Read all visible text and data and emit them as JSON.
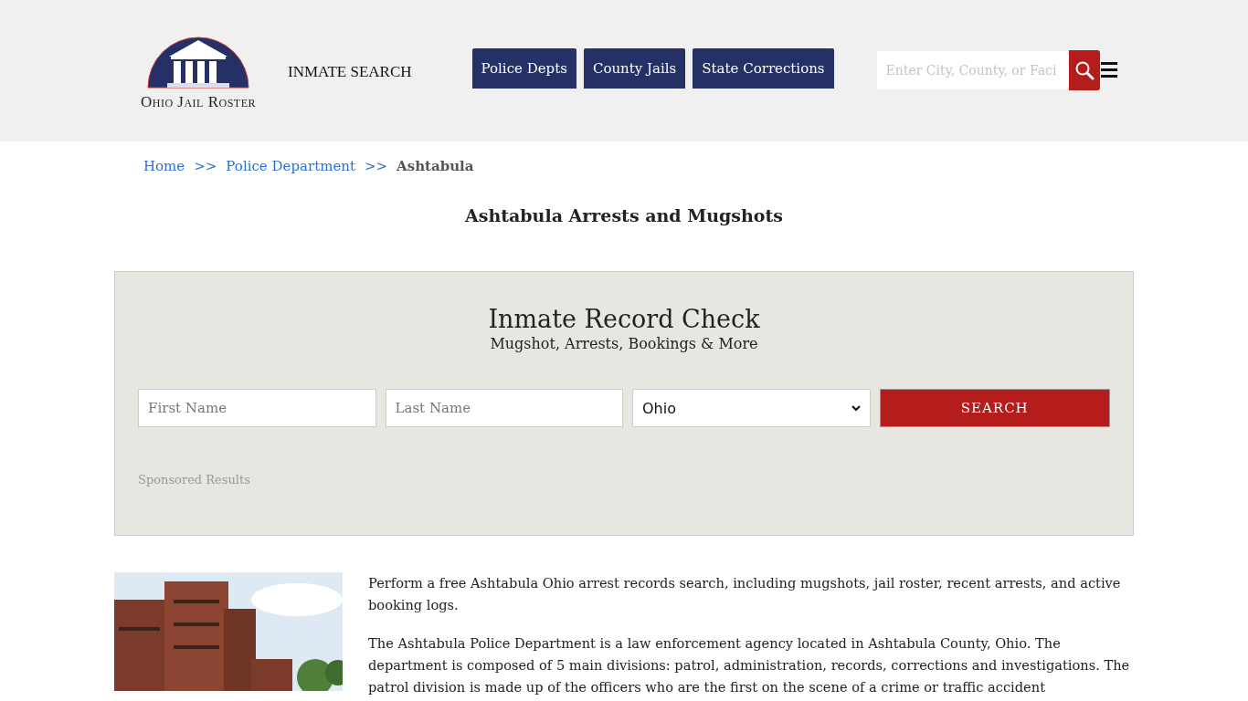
{
  "header": {
    "logo_text": "Ohio Jail Roster",
    "inmate_search": "INMATE SEARCH",
    "nav": [
      "Police Depts",
      "County Jails",
      "State Corrections"
    ],
    "search": {
      "placeholder": "Enter City, County, or Faci"
    }
  },
  "breadcrumb": [
    {
      "label": "Home",
      "kind": "link"
    },
    {
      "label": ">>",
      "kind": "separator"
    },
    {
      "label": "Police Department",
      "kind": "link"
    },
    {
      "label": ">>",
      "kind": "separator"
    },
    {
      "label": "Ashtabula",
      "kind": "current"
    }
  ],
  "page_title": "Ashtabula Arrests and Mugshots",
  "record_check": {
    "title": "Inmate Record Check",
    "subtitle": "Mugshot, Arrests, Bookings & More",
    "first_name": {
      "placeholder": "First Name"
    },
    "last_name": {
      "placeholder": "Last Name"
    },
    "state": {
      "value": "Ohio"
    },
    "button": "SEARCH",
    "sponsored": "Sponsored Results"
  },
  "article": {
    "image": {
      "kind": "picture"
    },
    "paragraphs": [
      "Perform a free Ashtabula Ohio arrest records search, including mugshots, jail roster, recent arrests, and active booking logs.",
      "The Ashtabula Police Department is a law enforcement agency located in Ashtabula County, Ohio. The department is composed of 5 main divisions: patrol, administration, records, corrections and investigations. The patrol division is made up of the officers who are the first on the scene of a crime or traffic accident"
    ]
  }
}
